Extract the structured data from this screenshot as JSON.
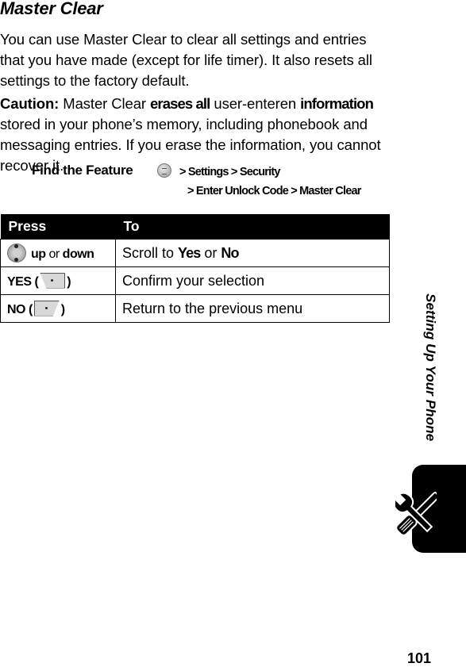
{
  "section_title": "Master Clear",
  "intro": "You can use Master Clear to clear all settings and entries that you have made (except for life timer). It also resets all settings to the factory default.",
  "caution": {
    "label": "Caution:",
    "text1": " Master Clear ",
    "bold1": "erases all",
    "text2": " user-enteren ",
    "bold2": "information",
    "text3": " stored in your phone’s memory, including phonebook and messaging entries. If you erase the information, you cannot recover it."
  },
  "find_feature": {
    "label": "Find the Feature",
    "menu_icon": "menu-key-icon",
    "path_line1": "> Settings > Security",
    "path_line2": "> Enter Unlock Code > Master Clear"
  },
  "table": {
    "headers": [
      "Press",
      "To"
    ],
    "rows": [
      {
        "press_icon": "nav-key-icon",
        "press_a": "up",
        "press_or": " or ",
        "press_b": "down",
        "to_a": "Scroll to ",
        "to_yes": "Yes",
        "to_or": " or ",
        "to_no": "No"
      },
      {
        "press_label": "YES (",
        "press_icon": "left-soft-key-icon",
        "press_close": ")",
        "to": "Confirm your selection"
      },
      {
        "press_label": "NO (",
        "press_icon": "right-soft-key-icon",
        "press_close": ")",
        "to": "Return to the previous menu"
      }
    ]
  },
  "side_tab": {
    "title": "Setting Up Your Phone",
    "icon": "wrench-screwdriver-icon"
  },
  "page_number": "101"
}
